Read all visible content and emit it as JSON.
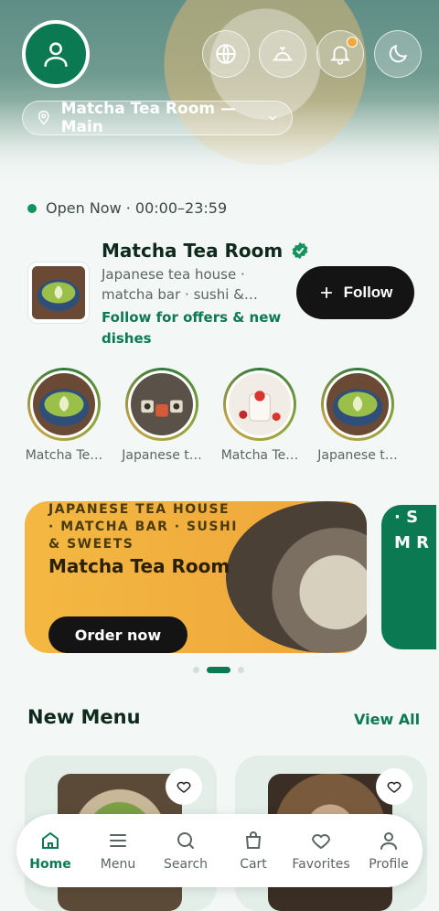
{
  "location": {
    "label": "Matcha Tea Room — Main"
  },
  "status": {
    "text": "Open Now · 00:00–23:59"
  },
  "shop": {
    "name": "Matcha Tea Room",
    "description": "Japanese tea house · matcha bar · sushi &…",
    "cta": "Follow for offers & new dishes",
    "follow_label": "Follow"
  },
  "stories": [
    {
      "label": "Matcha Te…"
    },
    {
      "label": "Japanese t…"
    },
    {
      "label": "Matcha Te…"
    },
    {
      "label": "Japanese t…"
    }
  ],
  "banner": {
    "tagline": "JAPANESE TEA HOUSE · MATCHA BAR · SUSHI & SWEETS",
    "title": "Matcha Tea Room",
    "button": "Order now"
  },
  "banner_next": {
    "text": "· S M R"
  },
  "carousel": {
    "count": 3,
    "active_index": 1
  },
  "new_menu": {
    "title": "New Menu",
    "view_all": "View All"
  },
  "nav": [
    {
      "label": "Home",
      "icon": "home-icon"
    },
    {
      "label": "Menu",
      "icon": "menu-icon"
    },
    {
      "label": "Search",
      "icon": "search-icon"
    },
    {
      "label": "Cart",
      "icon": "cart-icon"
    },
    {
      "label": "Favorites",
      "icon": "heart-icon"
    },
    {
      "label": "Profile",
      "icon": "profile-icon"
    }
  ],
  "colors": {
    "brand": "#0b7a53",
    "accent": "#f2a93b",
    "dark": "#141414"
  }
}
